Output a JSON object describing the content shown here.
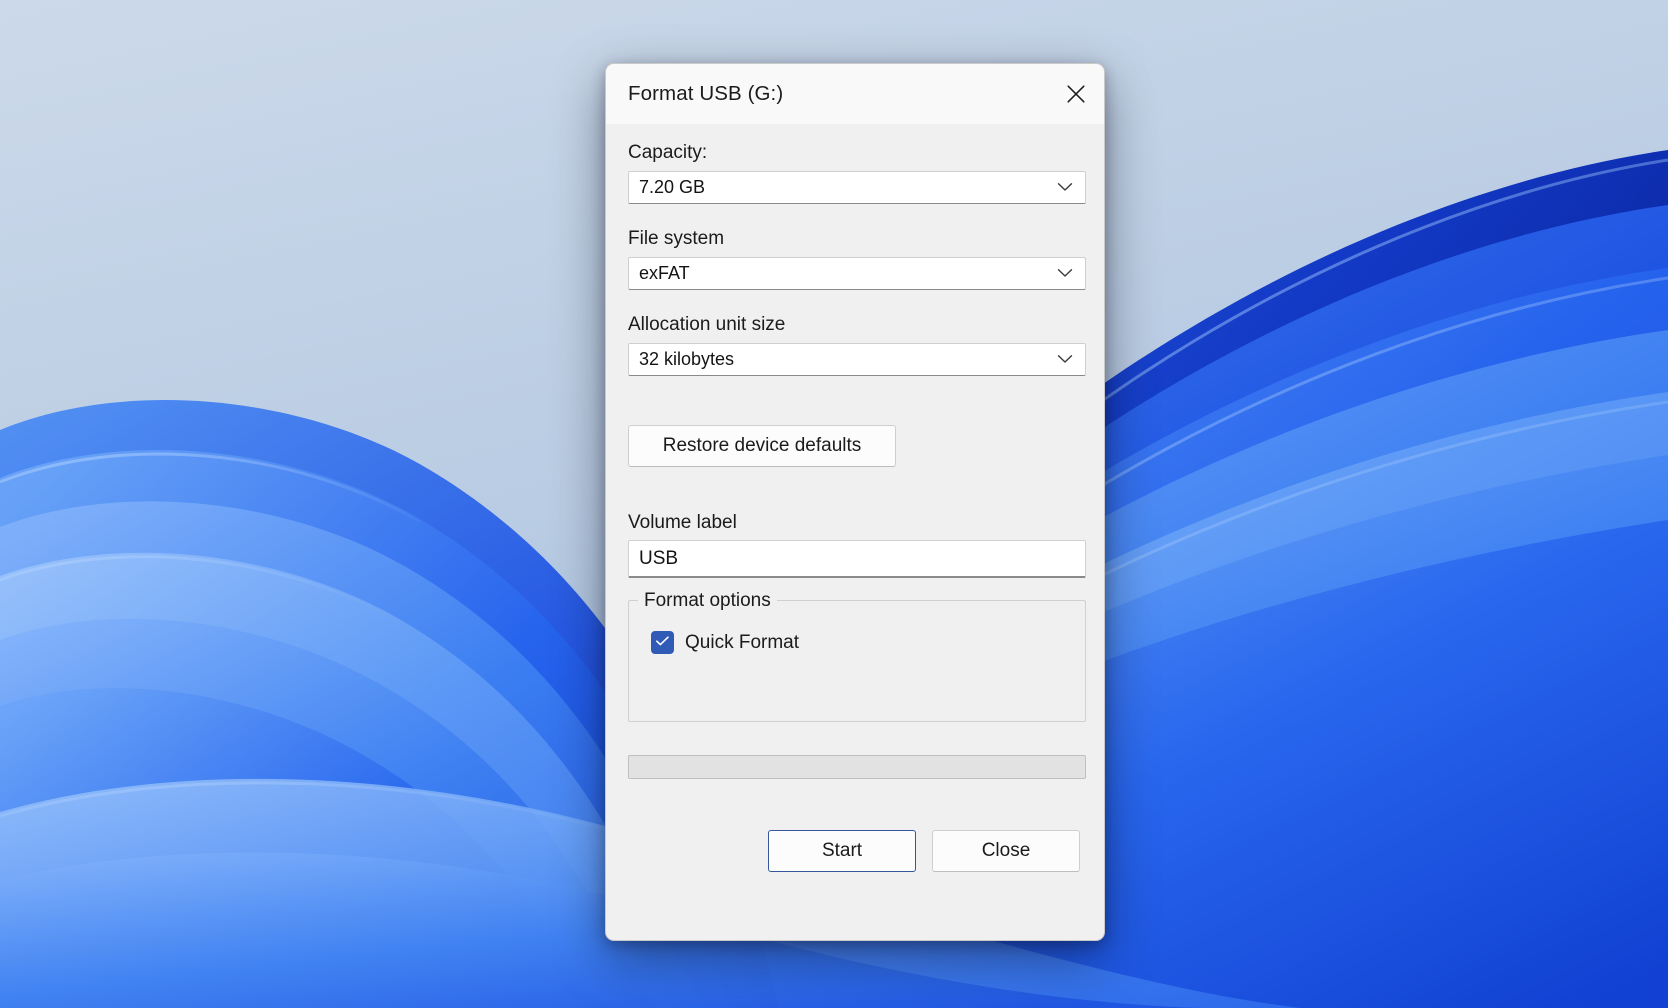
{
  "desktop": {
    "wallpaper_name": "windows-bloom-wallpaper",
    "colors": {
      "sky_top": "#c8d6e8",
      "ribbon_light": "#8cb8f5",
      "ribbon_mid": "#3f7ff0",
      "ribbon_deep": "#1b55ee",
      "ribbon_dark": "#0f32cc"
    }
  },
  "dialog": {
    "title": "Format USB (G:)",
    "close_icon": "close-icon",
    "capacity": {
      "label": "Capacity:",
      "value": "7.20 GB",
      "chevron_icon": "chevron-down-icon"
    },
    "file_system": {
      "label": "File system",
      "value": "exFAT",
      "chevron_icon": "chevron-down-icon"
    },
    "allocation_unit_size": {
      "label": "Allocation unit size",
      "value": "32 kilobytes",
      "chevron_icon": "chevron-down-icon"
    },
    "restore_defaults_label": "Restore device defaults",
    "volume_label": {
      "label": "Volume label",
      "value": "USB",
      "placeholder": ""
    },
    "format_options": {
      "legend": "Format options",
      "quick_format": {
        "label": "Quick Format",
        "checked": true,
        "accent_color": "#2f5bb7",
        "check_icon": "checkmark-icon"
      }
    },
    "progress": {
      "percent": 0
    },
    "footer": {
      "start_label": "Start",
      "close_label": "Close",
      "default_button_border": "#33569c"
    }
  }
}
